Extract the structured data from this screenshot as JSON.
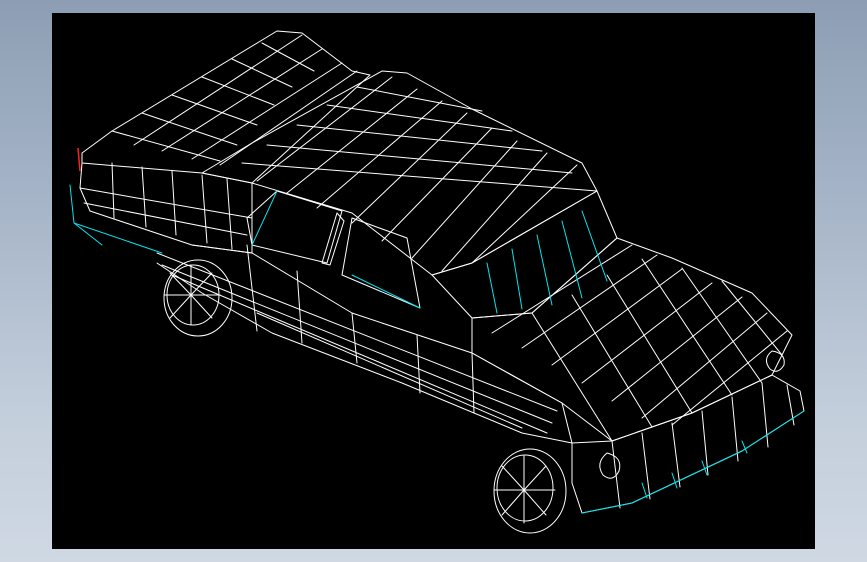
{
  "colors": {
    "frame_top": "#8d9eb4",
    "frame_bottom": "#cfd8e3",
    "viewport_background": "#000000",
    "mesh_primary": "#ffffff",
    "mesh_secondary": "#00e5ee",
    "mesh_accent": "#ff2020"
  },
  "scene": {
    "subject": "wireframe-car-model",
    "projection": "isometric"
  }
}
